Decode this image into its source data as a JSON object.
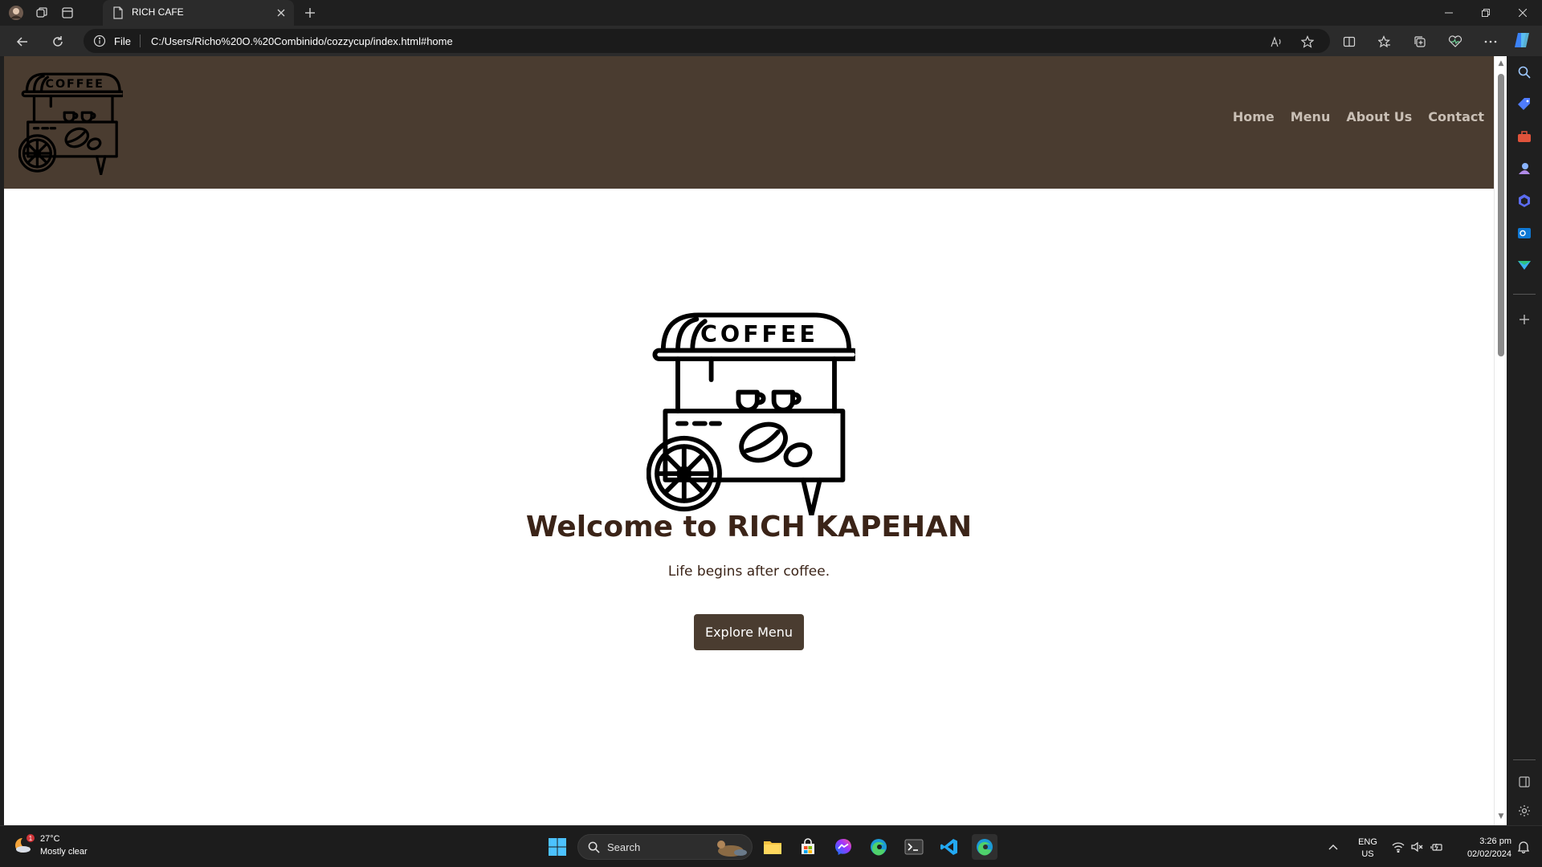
{
  "browser": {
    "tab_title": "RICH CAFE",
    "address_scheme": "File",
    "url": "C:/Users/Richo%20O.%20Combinido/cozzycup/index.html#home"
  },
  "site": {
    "logo_text": "COFFEE",
    "nav": [
      "Home",
      "Menu",
      "About Us",
      "Contact"
    ],
    "hero_title": "Welcome to RICH KAPEHAN",
    "hero_subtitle": "Life begins after coffee.",
    "cta_label": "Explore Menu",
    "colors": {
      "header": "#4a3c30",
      "text": "#3b2418",
      "button": "#4a3c30"
    }
  },
  "taskbar": {
    "weather_badge": "1",
    "weather_temp": "27°C",
    "weather_desc": "Mostly clear",
    "search_label": "Search",
    "lang_line1": "ENG",
    "lang_line2": "US",
    "time": "3:26 pm",
    "date": "02/02/2024"
  }
}
